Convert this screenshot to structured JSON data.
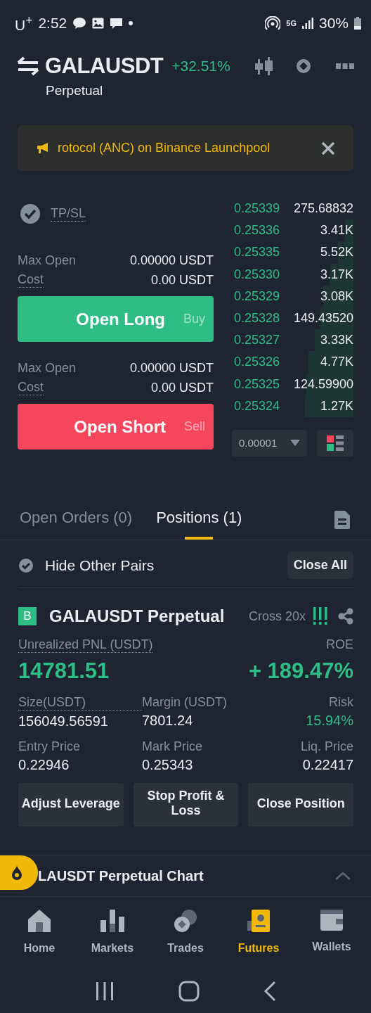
{
  "status_bar": {
    "carrier": "U$^{+}$",
    "time": "2:52",
    "network": "5G",
    "battery": "30%"
  },
  "header": {
    "symbol": "GALAUSDT",
    "change": "+32.51%",
    "subtitle": "Perpetual"
  },
  "banner": {
    "text": "rotocol (ANC) on Binance Launchpool"
  },
  "order_form": {
    "tpsl": {
      "label": "TP/SL",
      "checked": true
    },
    "blocks": [
      {
        "kind": "long",
        "max_label": "Max Open",
        "max_value": "0.00000 USDT",
        "cost_label": "Cost",
        "cost_value": "0.00 USDT",
        "button": "Open Long",
        "side": "Buy"
      },
      {
        "kind": "short",
        "max_label": "Max Open",
        "max_value": "0.00000 USDT",
        "cost_label": "Cost",
        "cost_value": "0.00 USDT",
        "button": "Open Short",
        "side": "Sell"
      }
    ]
  },
  "order_book": {
    "precision": "0.00001",
    "rows": [
      {
        "price": "0.25339",
        "amount": "275.68832"
      },
      {
        "price": "0.25336",
        "amount": "3.41K"
      },
      {
        "price": "0.25335",
        "amount": "5.52K"
      },
      {
        "price": "0.25330",
        "amount": "3.17K"
      },
      {
        "price": "0.25329",
        "amount": "3.08K"
      },
      {
        "price": "0.25328",
        "amount": "149.43520"
      },
      {
        "price": "0.25327",
        "amount": "3.33K"
      },
      {
        "price": "0.25326",
        "amount": "4.77K"
      },
      {
        "price": "0.25325",
        "amount": "124.59900"
      },
      {
        "price": "0.25324",
        "amount": "1.27K"
      }
    ]
  },
  "tabs": [
    {
      "label": "Open Orders (0)",
      "selected": false
    },
    {
      "label": "Positions (1)",
      "selected": true
    }
  ],
  "filter": {
    "label": "Hide Other Pairs",
    "checked": true,
    "button": "Close All"
  },
  "position": {
    "side_badge": "B",
    "title": "GALAUSDT Perpetual",
    "margin_mode": "Cross 20x",
    "pnl": {
      "label": "Unrealized PNL (USDT)",
      "value": "14781.51"
    },
    "roe": {
      "label": "ROE",
      "value": "+ 189.47%"
    },
    "fields": [
      {
        "kind": "amount",
        "label": "Size(USDT)",
        "value": "156049.56591"
      },
      {
        "kind": "amount",
        "label": "Margin (USDT)",
        "value": "7801.24"
      },
      {
        "kind": "ratio",
        "label": "Risk",
        "value": "15.94%"
      },
      {
        "kind": "amount",
        "label": "Entry Price",
        "value": "0.22946"
      },
      {
        "kind": "amount",
        "label": "Mark Price",
        "value": "0.25343"
      },
      {
        "kind": "amount",
        "label": "Liq. Price",
        "value": "0.22417"
      }
    ],
    "actions": [
      "Adjust Leverage",
      "Stop Profit & Loss",
      "Close Position"
    ]
  },
  "chart_bar": {
    "label": "LAUSDT Perpetual Chart"
  },
  "bottom_nav": [
    {
      "kind": "home",
      "label": "Home",
      "selected": false
    },
    {
      "kind": "markets",
      "label": "Markets",
      "selected": false
    },
    {
      "kind": "trades",
      "label": "Trades",
      "selected": false
    },
    {
      "kind": "futures",
      "label": "Futures",
      "selected": true
    },
    {
      "kind": "wallets",
      "label": "Wallets",
      "selected": false
    }
  ]
}
